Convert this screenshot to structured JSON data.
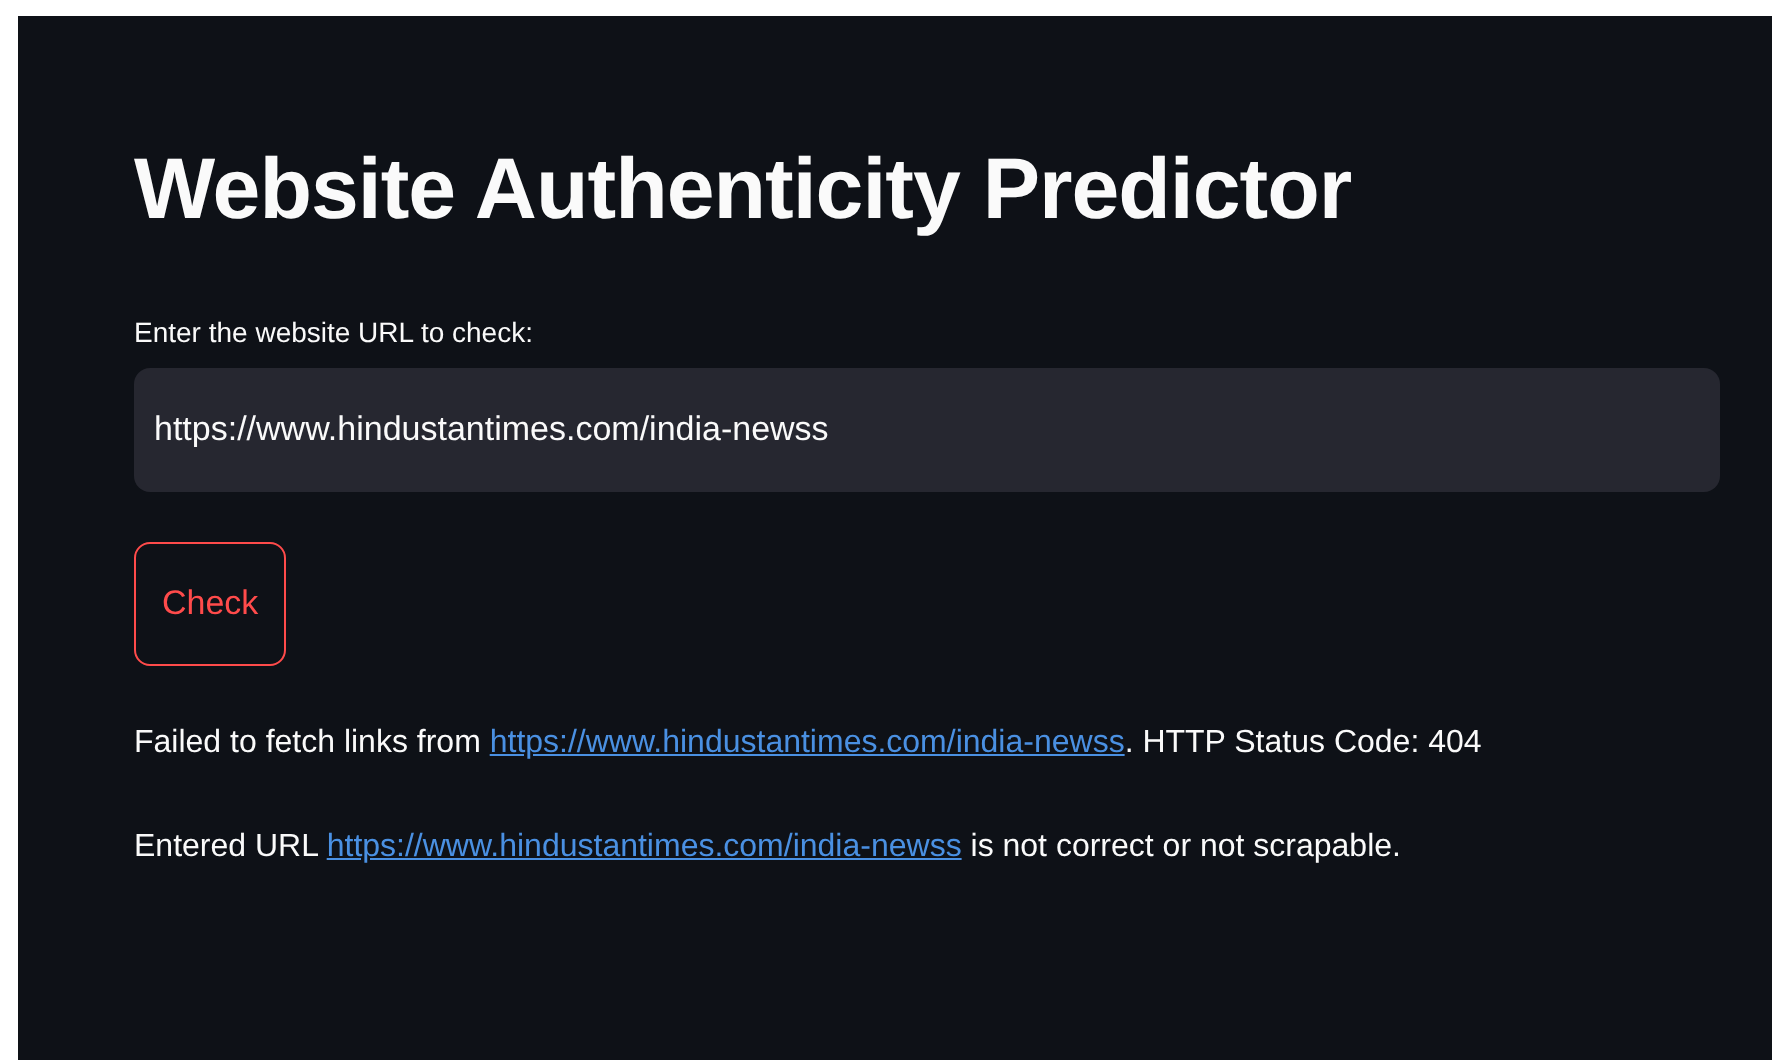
{
  "title": "Website Authenticity Predictor",
  "url_field": {
    "label": "Enter the website URL to check:",
    "value": "https://www.hindustantimes.com/india-newss"
  },
  "check_button": {
    "label": "Check"
  },
  "messages": [
    {
      "before": "Failed to fetch links from ",
      "link": "https://www.hindustantimes.com/india-newss",
      "after": ". HTTP Status Code: 404"
    },
    {
      "before": "Entered URL ",
      "link": "https://www.hindustantimes.com/india-newss",
      "after": " is not correct or not scrapable."
    }
  ]
}
